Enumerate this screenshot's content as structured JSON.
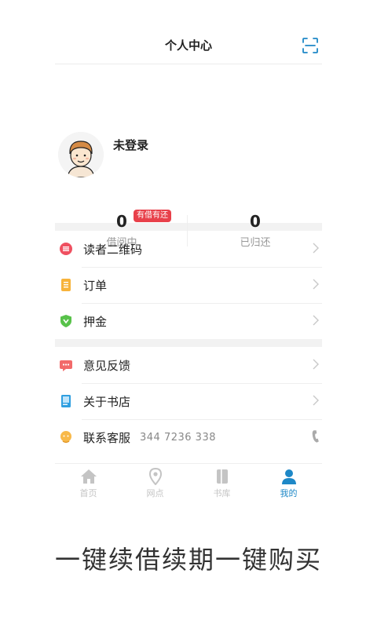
{
  "header": {
    "title": "个人中心",
    "scan_icon": "scan-icon"
  },
  "profile": {
    "avatar": "avatar",
    "username": "未登录"
  },
  "stats": {
    "borrowing": {
      "count": "0",
      "label": "借阅中",
      "tag": "有借有还"
    },
    "returned": {
      "count": "0",
      "label": "已归还"
    }
  },
  "menu_group_1": [
    {
      "icon": "qrcode-icon",
      "label": "读者二维码"
    },
    {
      "icon": "order-icon",
      "label": "订单"
    },
    {
      "icon": "deposit-shield-icon",
      "label": "押金"
    }
  ],
  "menu_group_2": [
    {
      "icon": "feedback-icon",
      "label": "意见反馈"
    },
    {
      "icon": "book-icon",
      "label": "关于书店"
    },
    {
      "icon": "service-icon",
      "label": "联系客服",
      "phone": "344  7236  338"
    }
  ],
  "tabbar": [
    {
      "icon": "home-icon",
      "label": "首页",
      "active": false
    },
    {
      "icon": "location-icon",
      "label": "网点",
      "active": false
    },
    {
      "icon": "library-icon",
      "label": "书库",
      "active": false
    },
    {
      "icon": "user-icon",
      "label": "我的",
      "active": true
    }
  ],
  "colors": {
    "accent": "#1e88c7",
    "tag_red": "#e8404a",
    "divider": "#f2f2f2"
  },
  "slogan": "一键续借续期一键购买"
}
